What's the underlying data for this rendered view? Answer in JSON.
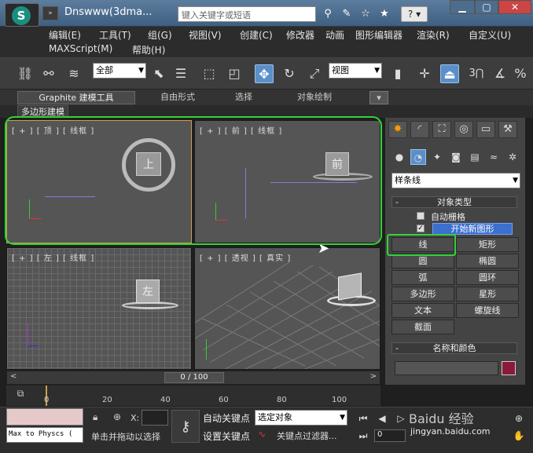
{
  "window": {
    "title": "Dnswww(3dma...",
    "search_placeholder": "键入关键字或短语",
    "help_label": "?"
  },
  "menu": {
    "row1": [
      "编辑(E)",
      "工具(T)",
      "组(G)",
      "视图(V)",
      "创建(C)",
      "修改器",
      "动画",
      "图形编辑器",
      "渲染(R)",
      "自定义(U)"
    ],
    "row2": [
      "MAXScript(M)",
      "帮助(H)"
    ]
  },
  "toolbar": {
    "selection_filter": "全部",
    "reference_coord": "视图",
    "snap_label": "3"
  },
  "ribbon": {
    "tabs": [
      "Graphite 建模工具",
      "自由形式",
      "选择",
      "对象绘制"
    ],
    "subtab": "多边形建模"
  },
  "viewports": {
    "top": "[ + ] [ 顶 ] [ 线框 ]",
    "front": "[ + ] [ 前 ] [ 线框 ]",
    "left": "[ + ] [ 左 ] [ 线框 ]",
    "persp": "[ + ] [ 透视 ] [ 真实 ]",
    "cube_top": "上",
    "cube_front": "前",
    "cube_left": "左"
  },
  "command_panel": {
    "category_dropdown": "样条线",
    "object_type_header": "对象类型",
    "auto_grid": "自动栅格",
    "start_new_shape": "开始新图形",
    "buttons": [
      [
        "线",
        "矩形"
      ],
      [
        "圆",
        "椭圆"
      ],
      [
        "弧",
        "圆环"
      ],
      [
        "多边形",
        "星形"
      ],
      [
        "文本",
        "螺旋线"
      ],
      [
        "截面",
        ""
      ]
    ],
    "name_color_header": "名称和颜色",
    "swatch_color": "#8b1a3a"
  },
  "timeline": {
    "slider_label": "0 / 100",
    "ticks": [
      "0",
      "20",
      "40",
      "60",
      "80",
      "100"
    ]
  },
  "status": {
    "maxscript_line": "Max to Physcs (",
    "prompt": "单击并拖动以选择",
    "x_label": "X:",
    "auto_key": "自动关键点",
    "set_key": "设置关键点",
    "selected_object": "选定对象",
    "key_filters": "关键点过滤器...",
    "frame": "0",
    "watermark": "Baidu 经验",
    "watermark_url": "jingyan.baidu.com"
  },
  "colors": {
    "highlight_green": "#33d33a",
    "active_viewport": "#c7a34a"
  }
}
